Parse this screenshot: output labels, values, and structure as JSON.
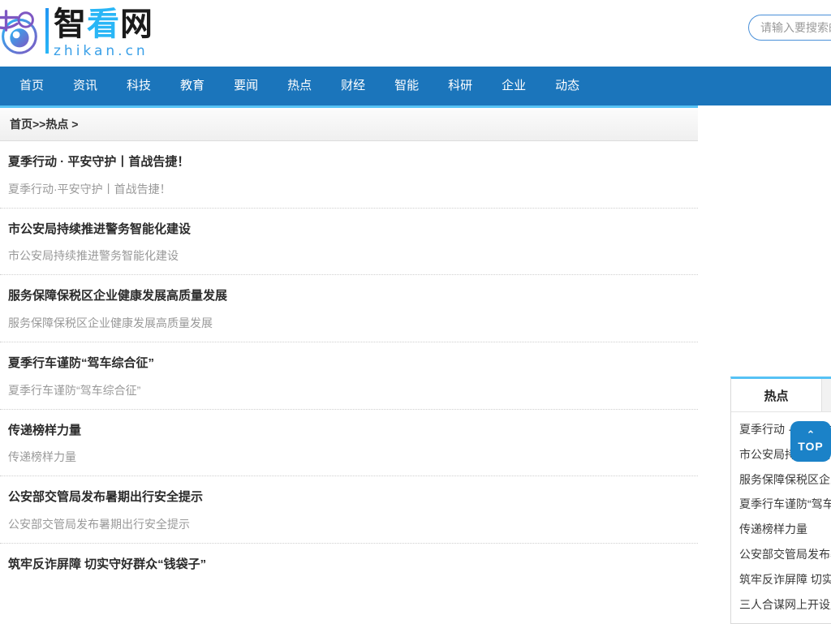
{
  "site": {
    "logo_cn_part1": "智",
    "logo_cn_part2": "看",
    "logo_cn_part3": "网",
    "logo_en": "zhikan.cn",
    "logo_icon": "eye-logo-icon"
  },
  "search": {
    "placeholder": "请输入要搜索的内容",
    "value": ""
  },
  "nav": {
    "items": [
      {
        "label": "首页"
      },
      {
        "label": "资讯"
      },
      {
        "label": "科技"
      },
      {
        "label": "教育"
      },
      {
        "label": "要闻"
      },
      {
        "label": "热点"
      },
      {
        "label": "财经"
      },
      {
        "label": "智能"
      },
      {
        "label": "科研"
      },
      {
        "label": "企业"
      },
      {
        "label": "动态"
      }
    ]
  },
  "breadcrumb": {
    "text": "首页>>热点 >"
  },
  "news": {
    "items": [
      {
        "title": "夏季行动 · 平安守护丨首战告捷！",
        "desc": "夏季行动·平安守护丨首战告捷！"
      },
      {
        "title": "市公安局持续推进警务智能化建设",
        "desc": "市公安局持续推进警务智能化建设"
      },
      {
        "title": "服务保障保税区企业健康发展高质量发展",
        "desc": "服务保障保税区企业健康发展高质量发展"
      },
      {
        "title": "夏季行车谨防“驾车综合征”",
        "desc": "夏季行车谨防“驾车综合征”"
      },
      {
        "title": "传递榜样力量",
        "desc": "传递榜样力量"
      },
      {
        "title": "公安部交管局发布暑期出行安全提示",
        "desc": "公安部交管局发布暑期出行安全提示"
      },
      {
        "title": "筑牢反诈屏障 切实守好群众“钱袋子”",
        "desc": ""
      }
    ]
  },
  "sidebar": {
    "tab_active": "热点",
    "tab_second": "",
    "items": [
      {
        "label": "夏季行动 · 平安守护丨首战告捷！"
      },
      {
        "label": "市公安局持续推进警务智能化建设"
      },
      {
        "label": "服务保障保税区企业健康发展高质量发展"
      },
      {
        "label": "夏季行车谨防“驾车综合征”"
      },
      {
        "label": "传递榜样力量"
      },
      {
        "label": "公安部交管局发布暑期出行安全提示"
      },
      {
        "label": "筑牢反诈屏障 切实守好群众“钱袋子”"
      },
      {
        "label": "三人合谋网上开设赌场"
      }
    ]
  },
  "top_button": {
    "label": "TOP",
    "chevron": "⌃"
  },
  "colors": {
    "nav_bg": "#1b75bb",
    "accent_blue": "#56c2f5",
    "top_btn": "#1b82c8",
    "logo_blue": "#29b6f6"
  }
}
